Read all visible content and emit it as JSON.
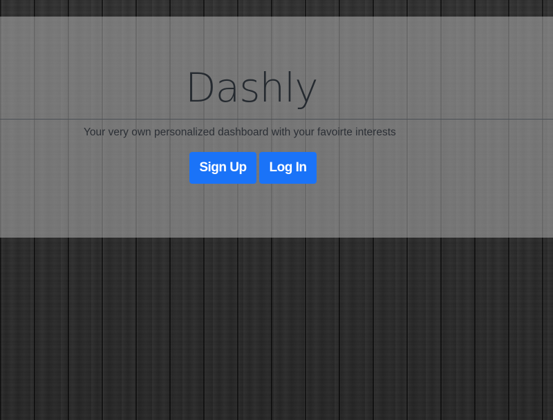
{
  "hero": {
    "title": "Dashly",
    "tagline": "Your very own personalized dashboard with your favoirte interests"
  },
  "actions": {
    "signup_label": "Sign Up",
    "login_label": "Log In"
  },
  "colors": {
    "primary_button": "#1a73f8",
    "button_text": "#ffffff",
    "title_text": "#252a30",
    "background": "#2a2a2a"
  }
}
